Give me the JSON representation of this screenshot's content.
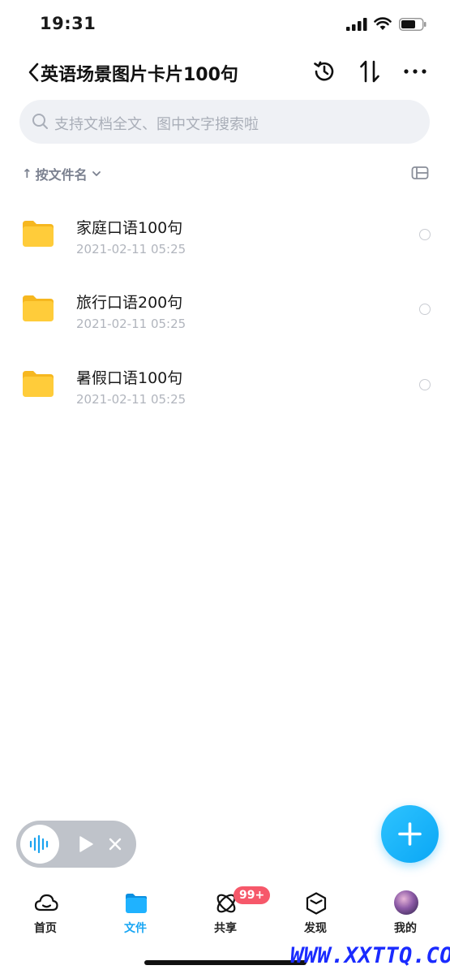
{
  "status_bar": {
    "time": "19:31"
  },
  "header": {
    "title": "英语场景图片卡片100句"
  },
  "search": {
    "placeholder": "支持文档全文、图中文字搜索啦"
  },
  "sort": {
    "arrow": "↑",
    "label": "按文件名"
  },
  "files": [
    {
      "name": "家庭口语100句",
      "date": "2021-02-11 05:25"
    },
    {
      "name": "旅行口语200句",
      "date": "2021-02-11 05:25"
    },
    {
      "name": "暑假口语100句",
      "date": "2021-02-11 05:25"
    }
  ],
  "tab_bar": {
    "items": [
      {
        "label": "首页",
        "icon": "cloud-icon"
      },
      {
        "label": "文件",
        "icon": "folder-icon",
        "active": true
      },
      {
        "label": "共享",
        "icon": "share-orbit-icon"
      },
      {
        "label": "发现",
        "icon": "cube-icon"
      },
      {
        "label": "我的",
        "icon": "avatar"
      }
    ],
    "share_badge": "99+"
  },
  "watermark": "WWW.XXTTQ.COM",
  "colors": {
    "accent": "#18a6f4",
    "folder": "#ffc933",
    "badge": "#f6586a"
  }
}
